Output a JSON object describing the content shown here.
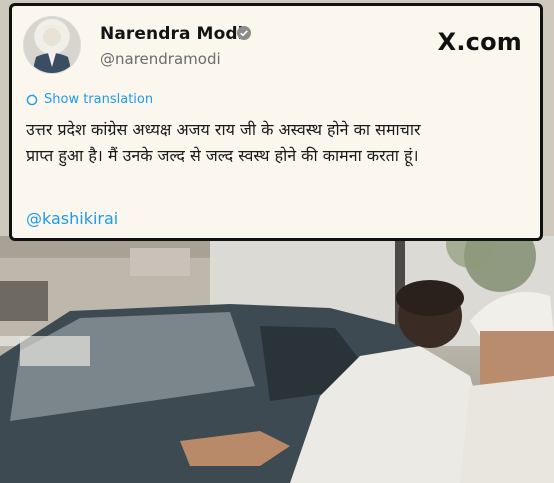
{
  "post": {
    "author_name": "Narendra Modi",
    "author_handle": "@narendramodi",
    "verified_icon": "verified-badge-icon",
    "site_label": "X.com",
    "show_translation": "Show translation",
    "text_line1": "उत्तर प्रदेश कांग्रेस अध्यक्ष अजय राय जी के अस्वस्थ होने का समाचार",
    "text_line2": "प्राप्त हुआ है। मैं उनके जल्द से जल्द स्वस्थ होने की कामना करता हूं।",
    "mention": "@kashikirai"
  },
  "colors": {
    "link_blue": "#1d9bf0",
    "card_bg": "#fbf7ef",
    "text": "#1a1a1a",
    "muted": "#6b6b6b"
  }
}
